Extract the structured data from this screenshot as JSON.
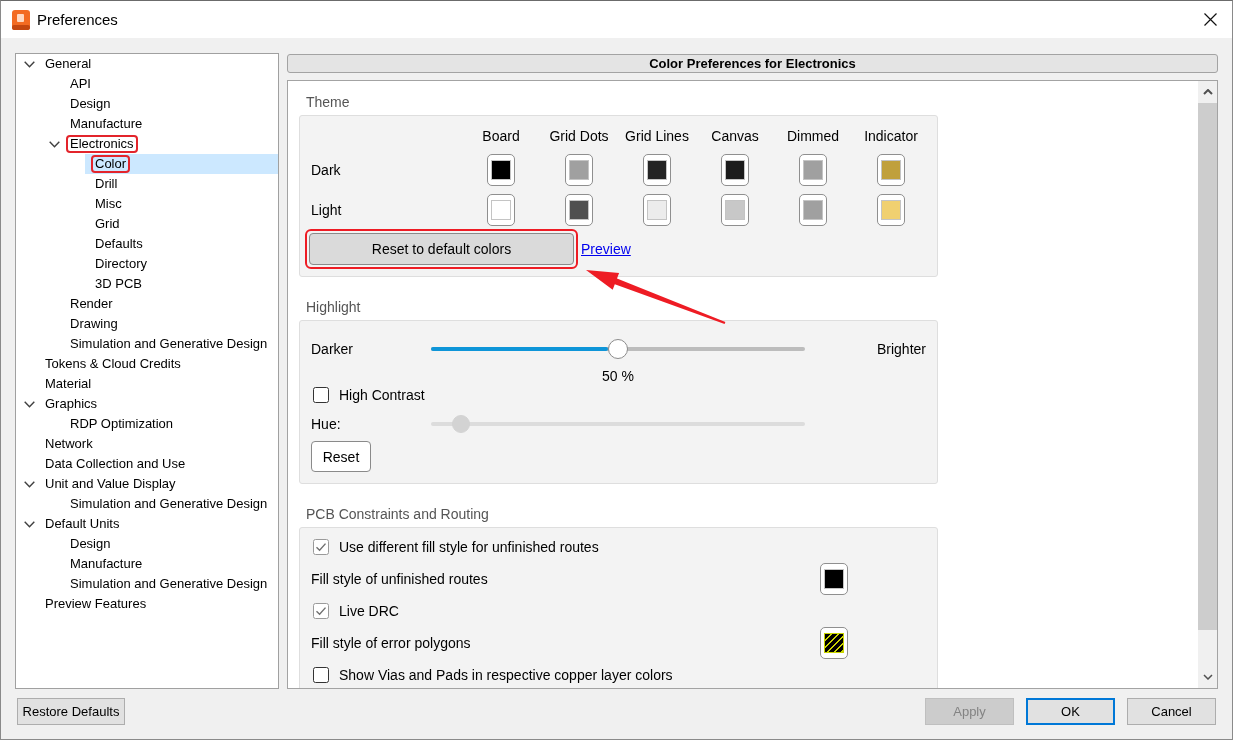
{
  "window": {
    "title": "Preferences"
  },
  "tree": [
    {
      "label": "General",
      "expanded": true,
      "selected": false,
      "annotated": false,
      "children": [
        {
          "label": "API",
          "selected": false,
          "annotated": false
        },
        {
          "label": "Design",
          "selected": false,
          "annotated": false
        },
        {
          "label": "Manufacture",
          "selected": false,
          "annotated": false
        },
        {
          "label": "Electronics",
          "expanded": true,
          "selected": false,
          "annotated": true,
          "children": [
            {
              "label": "Color",
              "selected": true,
              "annotated": true
            },
            {
              "label": "Drill",
              "selected": false,
              "annotated": false
            },
            {
              "label": "Misc",
              "selected": false,
              "annotated": false
            },
            {
              "label": "Grid",
              "selected": false,
              "annotated": false
            },
            {
              "label": "Defaults",
              "selected": false,
              "annotated": false
            },
            {
              "label": "Directory",
              "selected": false,
              "annotated": false
            },
            {
              "label": "3D PCB",
              "selected": false,
              "annotated": false
            }
          ]
        },
        {
          "label": "Render",
          "selected": false,
          "annotated": false
        },
        {
          "label": "Drawing",
          "selected": false,
          "annotated": false
        },
        {
          "label": "Simulation and Generative Design",
          "selected": false,
          "annotated": false
        }
      ]
    },
    {
      "label": "Tokens & Cloud Credits",
      "selected": false,
      "annotated": false
    },
    {
      "label": "Material",
      "selected": false,
      "annotated": false
    },
    {
      "label": "Graphics",
      "expanded": true,
      "selected": false,
      "annotated": false,
      "children": [
        {
          "label": "RDP Optimization",
          "selected": false,
          "annotated": false
        }
      ]
    },
    {
      "label": "Network",
      "selected": false,
      "annotated": false
    },
    {
      "label": "Data Collection and Use",
      "selected": false,
      "annotated": false
    },
    {
      "label": "Unit and Value Display",
      "expanded": true,
      "selected": false,
      "annotated": false,
      "children": [
        {
          "label": "Simulation and Generative Design",
          "selected": false,
          "annotated": false
        }
      ]
    },
    {
      "label": "Default Units",
      "expanded": true,
      "selected": false,
      "annotated": false,
      "children": [
        {
          "label": "Design",
          "selected": false,
          "annotated": false
        },
        {
          "label": "Manufacture",
          "selected": false,
          "annotated": false
        },
        {
          "label": "Simulation and Generative Design",
          "selected": false,
          "annotated": false
        }
      ]
    },
    {
      "label": "Preview Features",
      "selected": false,
      "annotated": false
    }
  ],
  "content": {
    "header": "Color Preferences for Electronics",
    "sections": [
      {
        "kind": "theme",
        "title": "Theme",
        "columns": [
          "Board",
          "Grid Dots",
          "Grid Lines",
          "Canvas",
          "Dimmed",
          "Indicator"
        ],
        "rows": [
          {
            "label": "Dark",
            "swatches": [
              {
                "color": "#000000"
              },
              {
                "color": "#a0a0a0"
              },
              {
                "color": "#232323"
              },
              {
                "color": "#1c1c1c"
              },
              {
                "color": "#a0a0a0"
              },
              {
                "color": "#c0a03c"
              }
            ]
          },
          {
            "label": "Light",
            "swatches": [
              {
                "color": "#ffffff"
              },
              {
                "color": "#505050"
              },
              {
                "color": "#ececec"
              },
              {
                "color": "#c8c8c8"
              },
              {
                "color": "#a0a0a0"
              },
              {
                "color": "#f0d070"
              }
            ]
          }
        ],
        "reset_button": {
          "label": "Reset to default colors",
          "annotated": true,
          "arrow": true
        },
        "link": "Preview"
      },
      {
        "kind": "highlight",
        "title": "Highlight",
        "slider": {
          "min_label": "Darker",
          "max_label": "Brighter",
          "level": 0.5,
          "reading": "50 %",
          "disabled": false
        },
        "checkbox": {
          "label": "High Contrast",
          "checked": false
        },
        "hue": {
          "label": "Hue:",
          "level": 0.08,
          "disabled": true
        },
        "reset_button": {
          "label": "Reset"
        }
      },
      {
        "kind": "pcb",
        "title": "PCB Constraints and Routing",
        "items": [
          {
            "kind": "checkbox",
            "label": "Use different fill style for unfinished routes",
            "checked": true
          },
          {
            "kind": "fill-style",
            "label": "Fill style of unfinished routes",
            "color": "#000000",
            "hatched": false
          },
          {
            "kind": "checkbox",
            "label": "Live DRC",
            "checked": true
          },
          {
            "kind": "fill-style",
            "label": "Fill style of error polygons",
            "color": "#000000",
            "hatched": true
          },
          {
            "kind": "checkbox",
            "label": "Show Vias and Pads in respective copper layer colors",
            "checked": false
          }
        ]
      }
    ]
  },
  "footer": {
    "left_buttons": [
      {
        "label": "Restore Defaults",
        "disabled": false,
        "default": false
      }
    ],
    "right_buttons": [
      {
        "label": "Apply",
        "disabled": true,
        "default": false
      },
      {
        "label": "OK",
        "disabled": false,
        "default": true
      },
      {
        "label": "Cancel",
        "disabled": false,
        "default": false
      }
    ]
  }
}
